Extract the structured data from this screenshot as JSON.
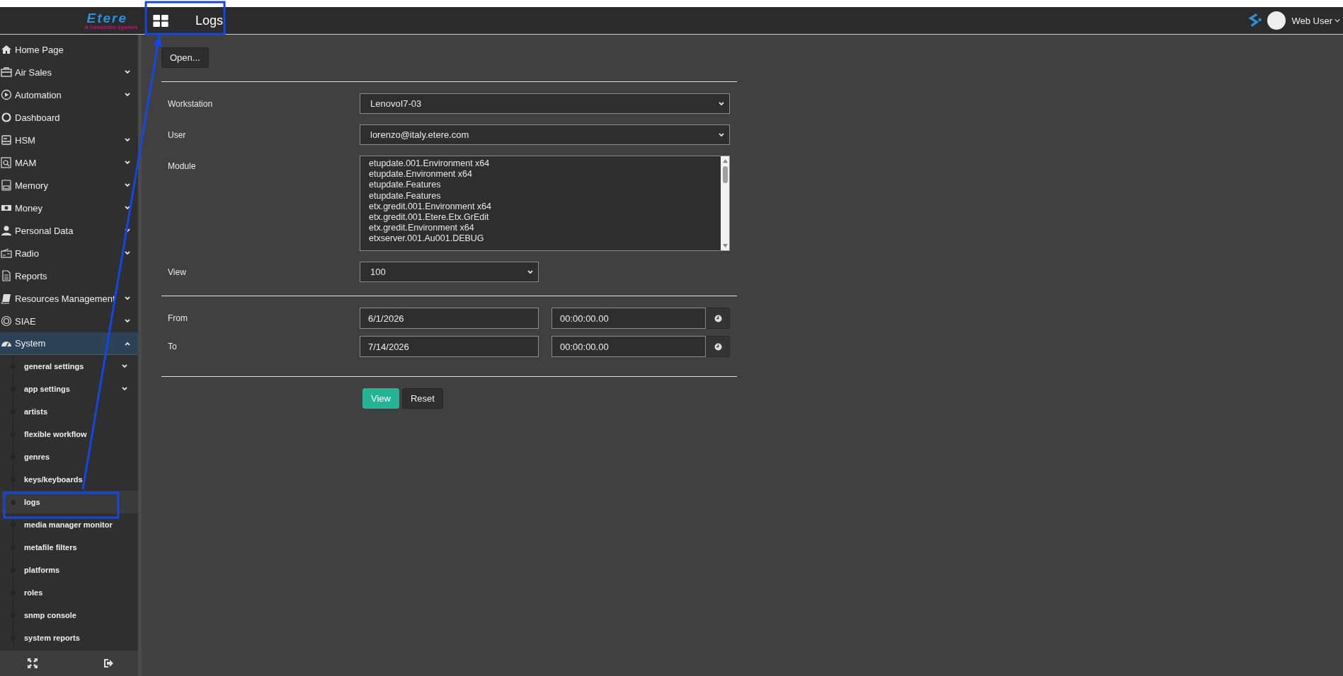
{
  "app": {
    "logo": "Etere",
    "tagline": "A consisten system"
  },
  "header": {
    "title": "Logs",
    "user": "Web User"
  },
  "sidebar": {
    "items": [
      {
        "label": "Home Page",
        "has_submenu": false,
        "expanded": false
      },
      {
        "label": "Air Sales",
        "has_submenu": true,
        "expanded": false
      },
      {
        "label": "Automation",
        "has_submenu": true,
        "expanded": false
      },
      {
        "label": "Dashboard",
        "has_submenu": false,
        "expanded": false
      },
      {
        "label": "HSM",
        "has_submenu": true,
        "expanded": false
      },
      {
        "label": "MAM",
        "has_submenu": true,
        "expanded": false
      },
      {
        "label": "Memory",
        "has_submenu": true,
        "expanded": false
      },
      {
        "label": "Money",
        "has_submenu": true,
        "expanded": false
      },
      {
        "label": "Personal Data",
        "has_submenu": true,
        "expanded": false
      },
      {
        "label": "Radio",
        "has_submenu": true,
        "expanded": false
      },
      {
        "label": "Reports",
        "has_submenu": false,
        "expanded": false
      },
      {
        "label": "Resources Management",
        "has_submenu": true,
        "expanded": false
      },
      {
        "label": "SIAE",
        "has_submenu": true,
        "expanded": false
      },
      {
        "label": "System",
        "has_submenu": true,
        "expanded": true,
        "children": [
          {
            "label": "general settings",
            "has_submenu": true,
            "selected": false
          },
          {
            "label": "app settings",
            "has_submenu": true,
            "selected": false
          },
          {
            "label": "artists",
            "has_submenu": false,
            "selected": false
          },
          {
            "label": "flexible workflow",
            "has_submenu": false,
            "selected": false
          },
          {
            "label": "genres",
            "has_submenu": false,
            "selected": false
          },
          {
            "label": "keys/keyboards",
            "has_submenu": false,
            "selected": false
          },
          {
            "label": "logs",
            "has_submenu": false,
            "selected": true
          },
          {
            "label": "media manager monitor",
            "has_submenu": false,
            "selected": false
          },
          {
            "label": "metafile filters",
            "has_submenu": false,
            "selected": false
          },
          {
            "label": "platforms",
            "has_submenu": false,
            "selected": false
          },
          {
            "label": "roles",
            "has_submenu": false,
            "selected": false
          },
          {
            "label": "snmp console",
            "has_submenu": false,
            "selected": false
          },
          {
            "label": "system reports",
            "has_submenu": false,
            "selected": false
          }
        ]
      }
    ]
  },
  "form": {
    "open_button": "Open...",
    "fields": [
      {
        "kind": "select",
        "label": "Workstation",
        "value": "LenovoI7-03"
      },
      {
        "kind": "select",
        "label": "User",
        "value": "lorenzo@italy.etere.com"
      },
      {
        "kind": "listbox",
        "label": "Module",
        "options": [
          "etupdate.001.Environment x64",
          "etupdate.Environment x64",
          "etupdate.Features",
          "etupdate.Features",
          "etx.gredit.001.Environment x64",
          "etx.gredit.001.Etere.Etx.GrEdit",
          "etx.gredit.Environment x64",
          "etxserver.001.Au001.DEBUG"
        ]
      },
      {
        "kind": "select-short",
        "label": "View",
        "value": "100"
      }
    ],
    "range": [
      {
        "label": "From",
        "date": "6/1/2026",
        "time": "00:00:00.00"
      },
      {
        "label": "To",
        "date": "7/14/2026",
        "time": "00:00:00.00"
      }
    ],
    "buttons": [
      {
        "label": "View",
        "kind": "primary"
      },
      {
        "label": "Reset",
        "kind": "default"
      }
    ]
  }
}
